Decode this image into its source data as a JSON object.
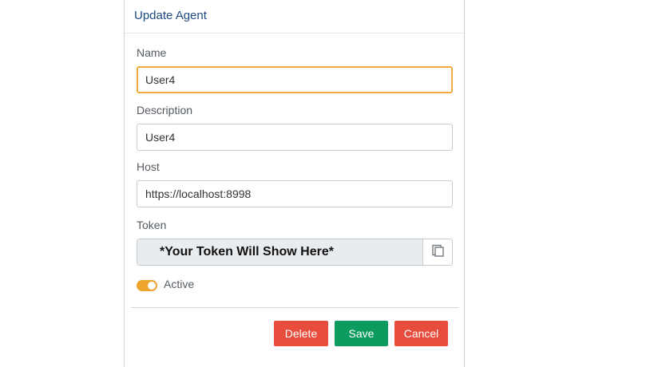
{
  "dialog": {
    "title": "Update Agent"
  },
  "form": {
    "name": {
      "label": "Name",
      "value": "User4"
    },
    "description": {
      "label": "Description",
      "value": "User4"
    },
    "host": {
      "label": "Host",
      "value": "https://localhost:8998"
    },
    "token": {
      "label": "Token",
      "value": "*Your Token Will Show Here*",
      "copy_icon": "copy-icon"
    },
    "active": {
      "label": "Active",
      "checked": true,
      "accent_color": "#f0a430"
    }
  },
  "footer": {
    "delete_label": "Delete",
    "save_label": "Save",
    "cancel_label": "Cancel"
  },
  "colors": {
    "title": "#1f4a80",
    "focus_border": "#f0ab3c",
    "danger": "#e74c3c",
    "success": "#0b9b5e"
  }
}
